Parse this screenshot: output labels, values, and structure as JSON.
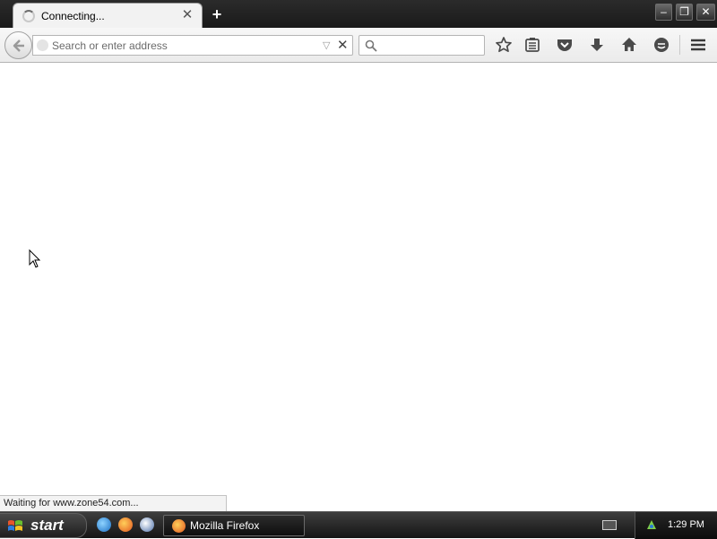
{
  "tab": {
    "title": "Connecting...",
    "close_symbol": "✕",
    "new_tab_symbol": "+"
  },
  "window_buttons": {
    "minimize": "–",
    "maximize": "❐",
    "close": "✕"
  },
  "navbar": {
    "address_placeholder": "Search or enter address",
    "stop_symbol": "✕",
    "dropmarker_symbol": "▽",
    "search_placeholder": ""
  },
  "toolbar_icons": [
    "star-icon",
    "reading-list-icon",
    "pocket-icon",
    "download-icon",
    "home-icon",
    "hello-icon",
    "menu-icon"
  ],
  "status": {
    "text": "Waiting for www.zone54.com..."
  },
  "taskbar": {
    "start_label": "start",
    "task_label": "Mozilla Firefox",
    "clock": "1:29 PM"
  },
  "colors": {
    "taskbar": "#151515",
    "tab_background": "#f2f2f2",
    "toolbar": "#ebebeb"
  }
}
